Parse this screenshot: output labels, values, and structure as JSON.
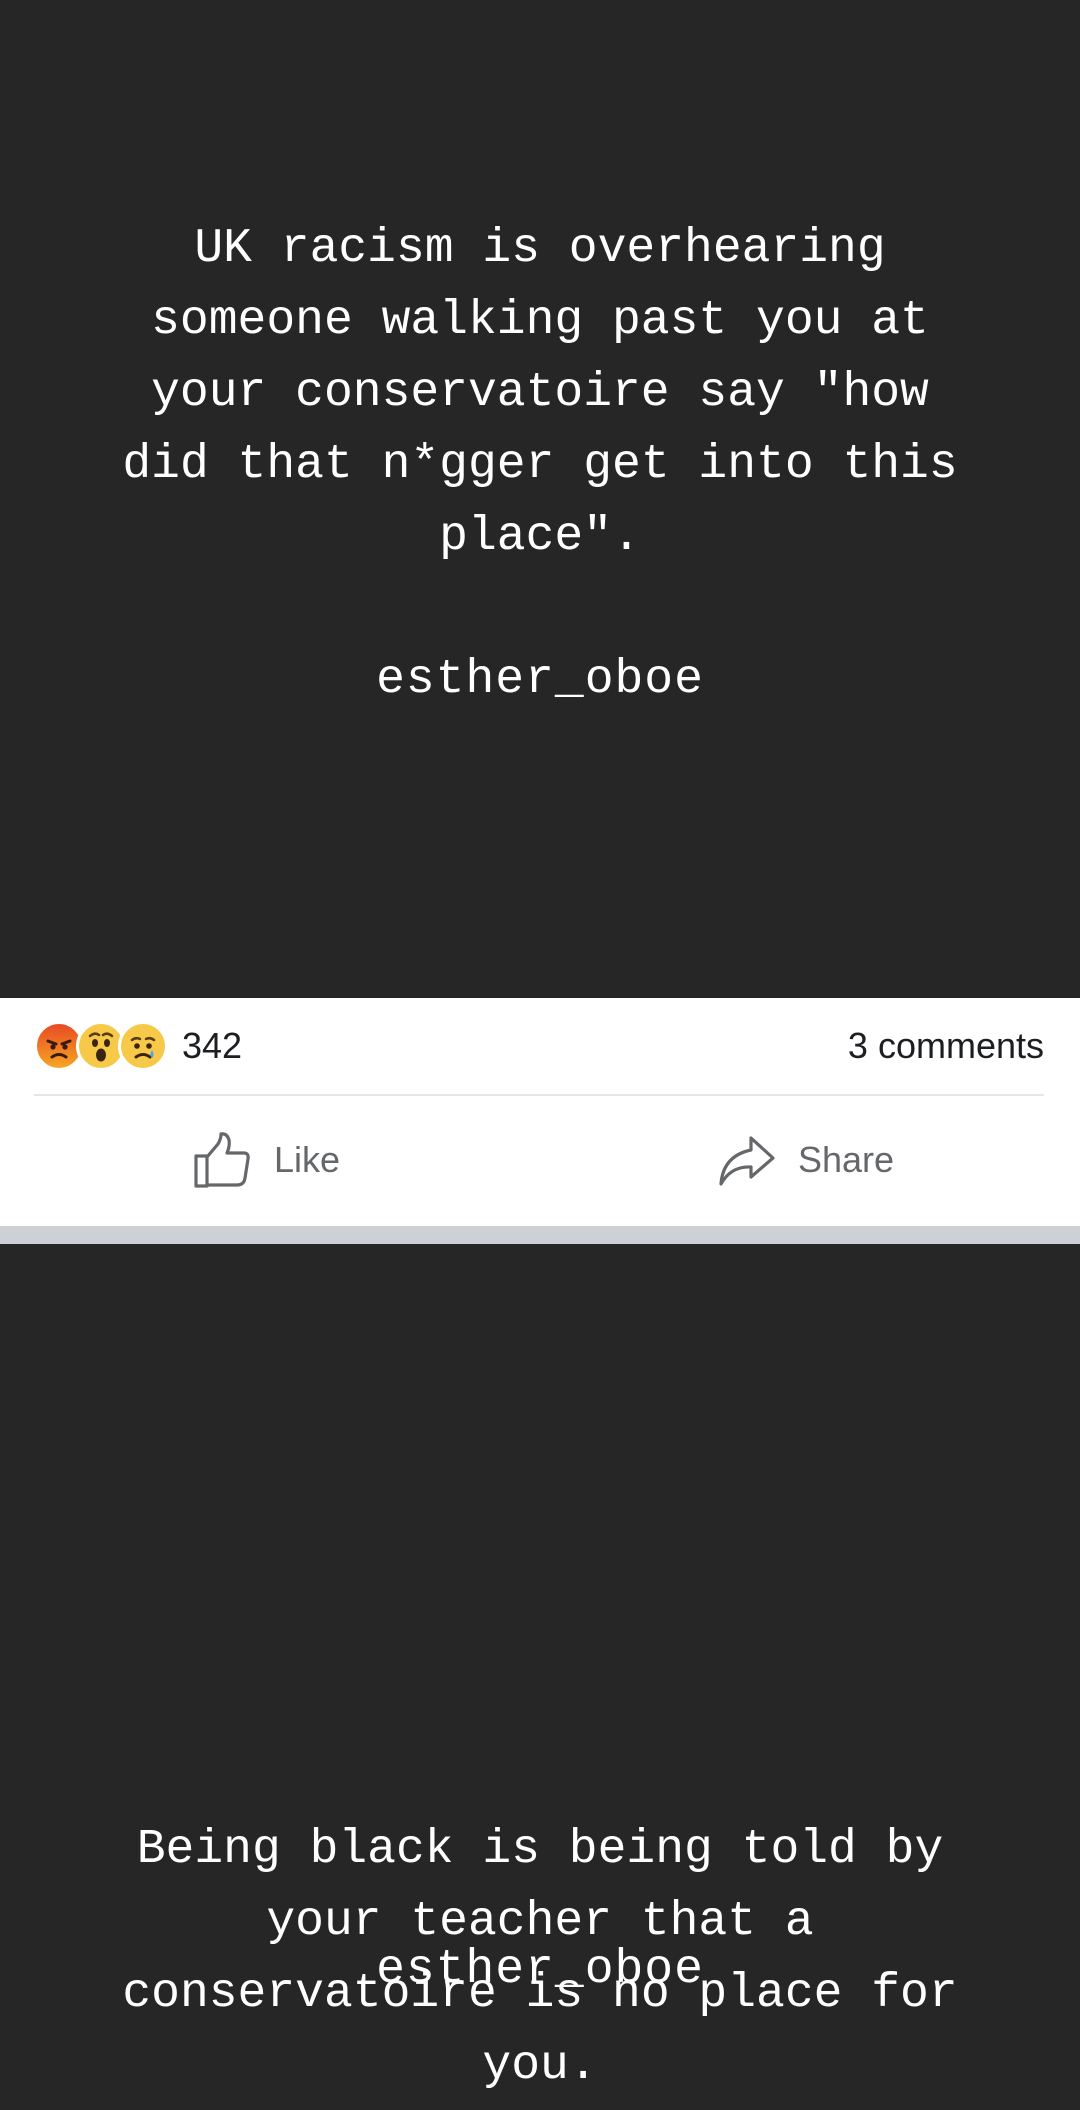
{
  "post_top": {
    "quote": "UK racism is overhearing\nsomeone walking past you at\nyour conservatoire say \"how\ndid that n*gger get into this\nplace\".",
    "handle": "esther_oboe"
  },
  "engagement": {
    "reactions": [
      "angry-emoji",
      "wow-emoji",
      "sad-emoji"
    ],
    "reaction_count": "342",
    "comments": "3 comments",
    "like_label": "Like",
    "share_label": "Share"
  },
  "post_bottom": {
    "quote": "Being black is being told by\nyour teacher that a\nconservatoire is no place for\nyou.",
    "handle": "esther_oboe"
  },
  "colors": {
    "background": "#262626",
    "text": "#ffffff",
    "panel": "#ffffff",
    "separator": "#cdd0d4",
    "action_text": "#65676b"
  }
}
